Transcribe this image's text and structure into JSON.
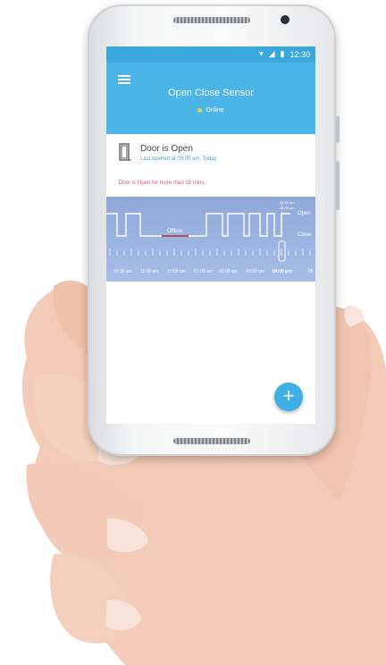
{
  "status_bar": {
    "time": "12:30"
  },
  "app_bar": {
    "title": "Open Close Sensor",
    "status": "Online"
  },
  "door": {
    "title": "Door is Open",
    "subtitle": "Last opened at 09:00 am, Today",
    "alert": "Door is Open for more than 15 mins."
  },
  "timeline": {
    "open_label": "Open",
    "close_label": "Close",
    "offline_label": "Offline",
    "top_times": [
      "04:05 am",
      "04:08 am"
    ],
    "times": [
      "10:30 am",
      "11:00 am",
      "12:00 am",
      "01:00 am",
      "02:00 am",
      "03:00 am",
      "04:00 pm",
      "05"
    ]
  },
  "fab": {
    "label": "+"
  }
}
